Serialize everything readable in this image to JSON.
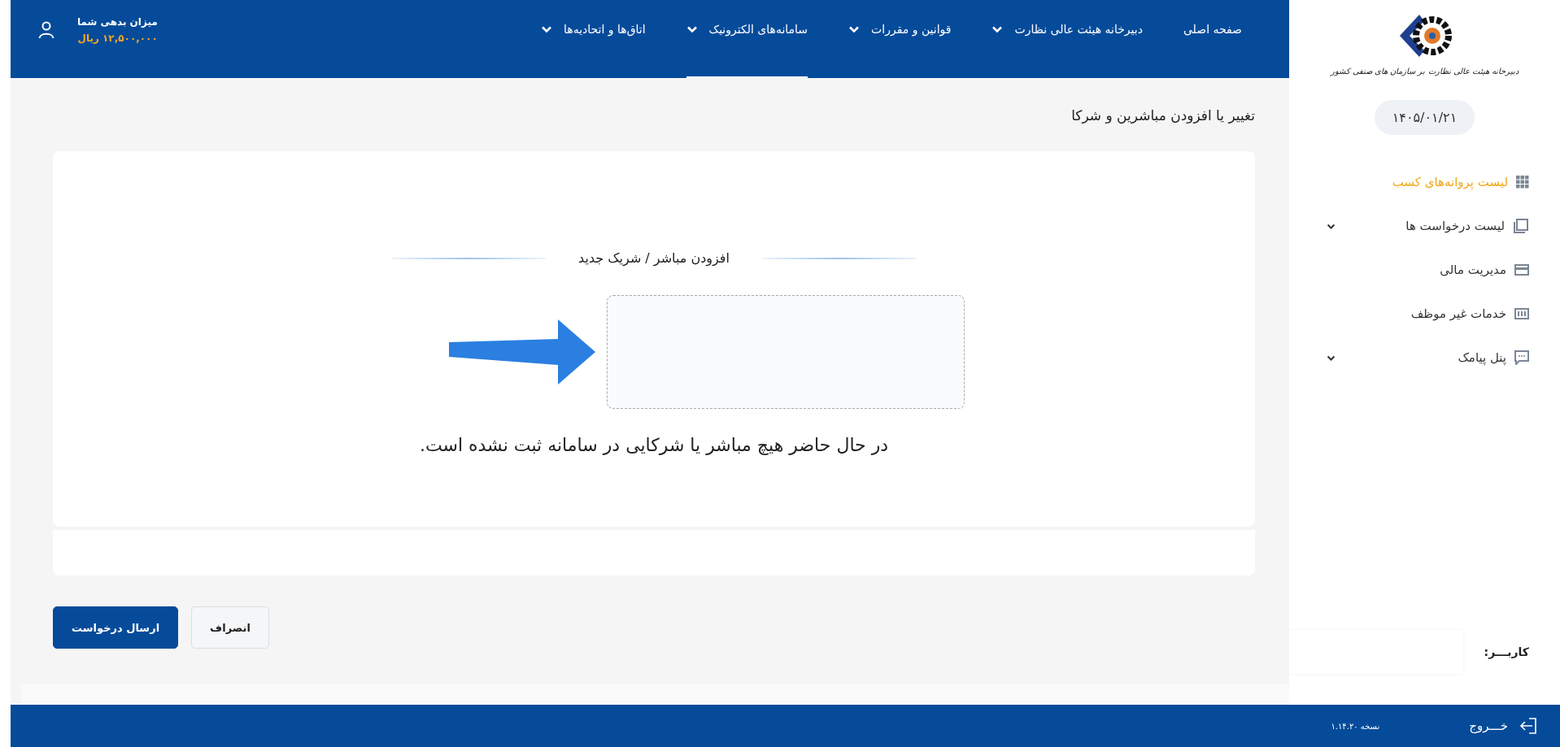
{
  "sidebar": {
    "logo_caption": "دبیرخانه هیئت عالی نظارت بر سازمان های صنفی کشور",
    "date": "۱۴۰۵/۰۱/۲۱",
    "menu": [
      {
        "label": "لیست پروانه‌های کسب",
        "selected": true,
        "has_submenu": false
      },
      {
        "label": "لیست درخواست ها",
        "selected": false,
        "has_submenu": true
      },
      {
        "label": "مدیریت مالی",
        "selected": false,
        "has_submenu": false
      },
      {
        "label": "خدمات غیر موظف",
        "selected": false,
        "has_submenu": false
      },
      {
        "label": "پنل پیامک",
        "selected": false,
        "has_submenu": true
      }
    ],
    "user_label": "کاربـــر:"
  },
  "nav": {
    "items": [
      {
        "label": "صفحه اصلی",
        "selected": false,
        "has_dropdown": false
      },
      {
        "label": "دبیرخانه هیئت عالی نظارت",
        "selected": false,
        "has_dropdown": true
      },
      {
        "label": "قوانین و مقررات",
        "selected": false,
        "has_dropdown": true
      },
      {
        "label": "سامانه‌های الکترونیک",
        "selected": true,
        "has_dropdown": true
      },
      {
        "label": "اتاق‌ها و اتحادیه‌ها",
        "selected": false,
        "has_dropdown": true
      }
    ],
    "debt": {
      "label": "میزان بدهی شما",
      "amount": "۱۲,۵۰۰,۰۰۰",
      "currency": "ریال"
    }
  },
  "page_title": "تغییر یا افزودن مباشرین و شرکا",
  "section_title": "افزودن مباشر / شریک جدید",
  "empty_message": "در حال حاضر هیچ مباشر یا شرکایی در سامانه ثبت نشده است.",
  "buttons": [
    {
      "label": "انصراف",
      "kind": "secondary"
    },
    {
      "label": "ارسال درخواست",
      "kind": "primary"
    }
  ],
  "footer": {
    "logout": "خـــروج",
    "version": "نسخه ۱.۱۴.۲۰"
  }
}
